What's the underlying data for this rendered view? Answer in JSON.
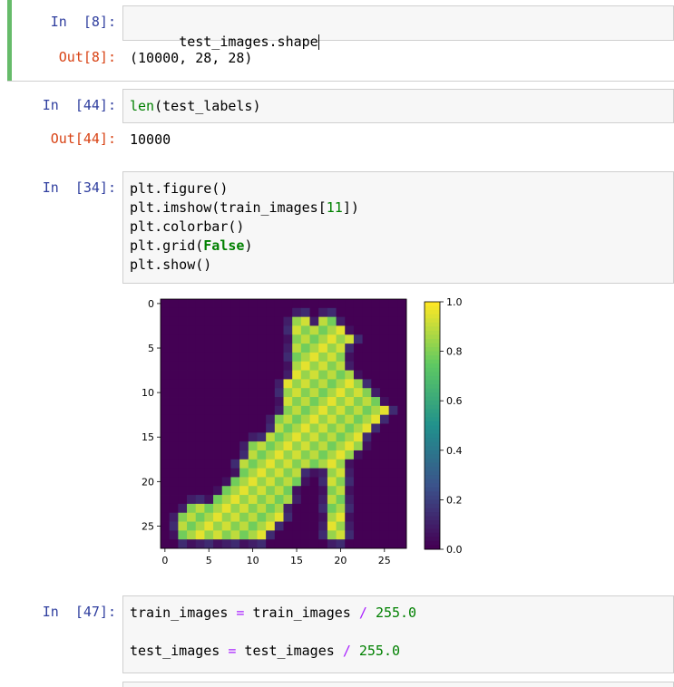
{
  "cells": [
    {
      "in_prompt": "In  [8]:",
      "input": [
        "test_images.shape"
      ],
      "out_prompt": "Out[8]:",
      "output": "(10000, 28, 28)"
    },
    {
      "in_prompt": "In  [44]:",
      "input": [
        "len(test_labels)"
      ],
      "out_prompt": "Out[44]:",
      "output": "10000"
    },
    {
      "in_prompt": "In  [34]:",
      "input": [
        "plt.figure()",
        "plt.imshow(train_images[11])",
        "plt.colorbar()",
        "plt.grid(False)",
        "plt.show()"
      ]
    },
    {
      "in_prompt": "In  [47]:",
      "input": [
        "train_images = train_images / 255.0",
        "",
        "test_images = test_images / 255.0"
      ]
    }
  ],
  "colors": {
    "in_prompt": "#303f9f",
    "out_prompt": "#d84315",
    "selected_cell": "#66bb6a",
    "keyword": "#008000",
    "operator": "#aa22ff",
    "input_bg": "#f7f7f7"
  },
  "chart_data": {
    "type": "heatmap",
    "x_ticks": [
      "0",
      "5",
      "10",
      "15",
      "20",
      "25"
    ],
    "y_ticks": [
      "0",
      "5",
      "10",
      "15",
      "20",
      "25"
    ],
    "xlim": [
      -0.5,
      27.5
    ],
    "ylim": [
      27.5,
      -0.5
    ],
    "grid": false,
    "colormap": "viridis",
    "colorbar": {
      "range": [
        0.0,
        1.0
      ],
      "ticks": [
        "0.0",
        "0.2",
        "0.4",
        "0.6",
        "0.8",
        "1.0"
      ]
    },
    "shape": [
      28,
      28
    ],
    "rows": [
      "............................",
      "............................",
      "...............##.##........",
      "...............######.......",
      "...............#######......",
      "...............######.......",
      "...............######.......",
      "...............######.......",
      "...............#######......",
      "..............#########.....",
      "..............##########....",
      "..............###########...",
      "..............############..",
      ".............############...",
      ".............###########....",
      "............###########.....",
      "..........#############.....",
      "..........############......",
      ".........############.......",
      ".........#######...##.......",
      "........########...##.......",
      ".......########....##.......",
      "......#########....##.......",
      "...###########.....##.......",
      "..############.....##.......",
      "..###########......##.......",
      "..##########.......##.......",
      "............................"
    ]
  }
}
